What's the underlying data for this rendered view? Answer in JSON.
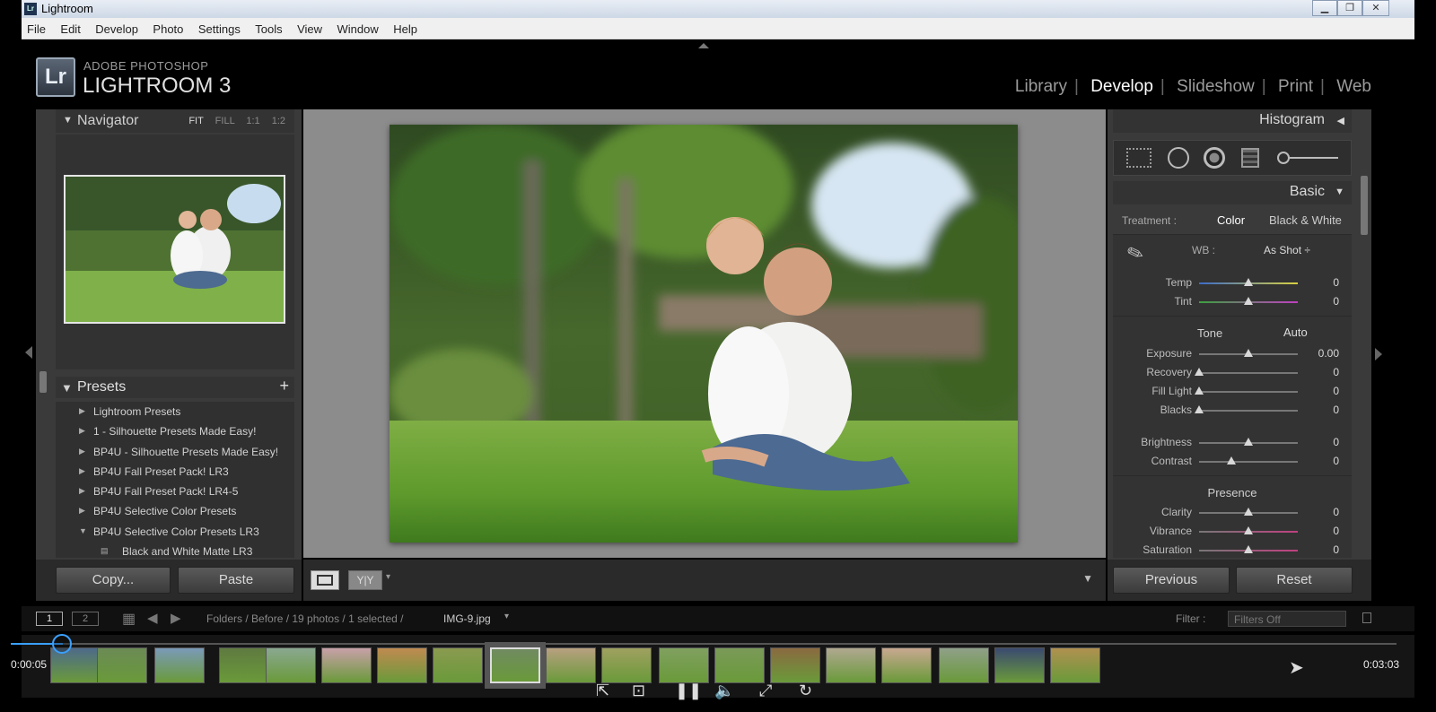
{
  "window": {
    "title": "Lightroom",
    "app_icon": "Lr",
    "controls": [
      "minimize-icon",
      "maximize-icon",
      "close-icon"
    ]
  },
  "menu": [
    "File",
    "Edit",
    "Develop",
    "Photo",
    "Settings",
    "Tools",
    "View",
    "Window",
    "Help"
  ],
  "brand": {
    "logo": "Lr",
    "line1": "ADOBE PHOTOSHOP",
    "line2": "LIGHTROOM 3"
  },
  "modules": {
    "items": [
      "Library",
      "Develop",
      "Slideshow",
      "Print",
      "Web"
    ],
    "active": "Develop"
  },
  "navigator": {
    "title": "Navigator",
    "zoom": [
      "FIT",
      "FILL",
      "1:1",
      "1:2"
    ],
    "zoom_active": "FIT"
  },
  "presets": {
    "title": "Presets",
    "add": "+",
    "items": [
      {
        "label": "Lightroom Presets",
        "state": "collapsed"
      },
      {
        "label": "1 - Silhouette Presets Made Easy!",
        "state": "collapsed"
      },
      {
        "label": "BP4U - Silhouette Presets Made Easy!",
        "state": "collapsed"
      },
      {
        "label": "BP4U Fall Preset Pack! LR3",
        "state": "collapsed"
      },
      {
        "label": "BP4U Fall Preset Pack! LR4-5",
        "state": "collapsed"
      },
      {
        "label": "BP4U Selective Color Presets",
        "state": "collapsed"
      },
      {
        "label": "BP4U Selective Color Presets LR3",
        "state": "expanded"
      }
    ],
    "child": "Black and White Matte LR3"
  },
  "left_buttons": {
    "copy": "Copy...",
    "paste": "Paste"
  },
  "toolbar": {
    "compare": "Y|Y"
  },
  "histogram": {
    "title": "Histogram"
  },
  "basic": {
    "title": "Basic",
    "treatment_label": "Treatment :",
    "treatment_options": [
      "Color",
      "Black & White"
    ],
    "treatment_active": "Color",
    "wb_label": "WB :",
    "wb_value": "As Shot ÷",
    "tone_label": "Tone",
    "auto_label": "Auto",
    "presence_label": "Presence",
    "sliders": [
      {
        "label": "Temp",
        "value": "0",
        "pos": 0.5
      },
      {
        "label": "Tint",
        "value": "0",
        "pos": 0.5
      },
      {
        "label": "Exposure",
        "value": "0.00",
        "pos": 0.5
      },
      {
        "label": "Recovery",
        "value": "0",
        "pos": 0.0
      },
      {
        "label": "Fill Light",
        "value": "0",
        "pos": 0.0
      },
      {
        "label": "Blacks",
        "value": "0",
        "pos": 0.0
      },
      {
        "label": "Brightness",
        "value": "0",
        "pos": 0.5
      },
      {
        "label": "Contrast",
        "value": "0",
        "pos": 0.33
      },
      {
        "label": "Clarity",
        "value": "0",
        "pos": 0.5
      },
      {
        "label": "Vibrance",
        "value": "0",
        "pos": 0.5
      },
      {
        "label": "Saturation",
        "value": "0",
        "pos": 0.5
      }
    ]
  },
  "right_buttons": {
    "previous": "Previous",
    "reset": "Reset"
  },
  "filmbar": {
    "page1": "1",
    "page2": "2",
    "path": "Folders / Before / 19 photos / 1 selected /",
    "filename": "IMG-9.jpg",
    "filter_label": "Filter :",
    "filter_value": "Filters Off"
  },
  "player": {
    "current": "0:00:05",
    "total": "0:03:03",
    "progress": 0.027
  },
  "thumbs": [
    "#4d6a8a",
    "#6b8a55",
    "#7a9ab8",
    "#5f7a40",
    "#8aa890",
    "#c8a0a8",
    "#c08a50",
    "#8a9a50",
    "#708a60",
    "#b8a080",
    "#a0a060",
    "#80a060",
    "#7a9a58",
    "#8a6a40",
    "#b0a890",
    "#c8a890",
    "#90a088",
    "#3a4a70",
    "#b09050",
    "#708a68"
  ]
}
